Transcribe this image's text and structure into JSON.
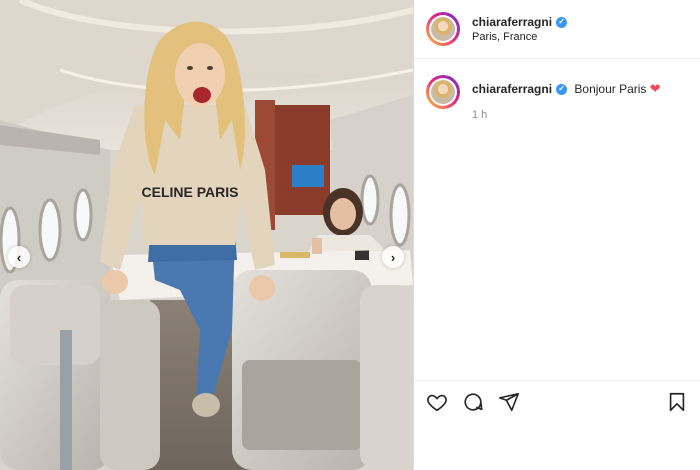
{
  "post": {
    "username": "chiaraferragni",
    "location": "Paris, France",
    "caption_user": "chiaraferragni",
    "caption": "Bonjour Paris",
    "caption_emoji": "❤",
    "time": "1 h",
    "photo_sweatshirt_text": "CELINE PARIS"
  },
  "icons": [
    "verified-icon",
    "heart-icon",
    "comment-icon",
    "share-icon",
    "bookmark-icon",
    "chevron-left-icon",
    "chevron-right-icon"
  ],
  "colors": {
    "verified": "#3897f0",
    "heart": "#ed4956",
    "text": "#262626",
    "muted": "#8e8e8e"
  }
}
